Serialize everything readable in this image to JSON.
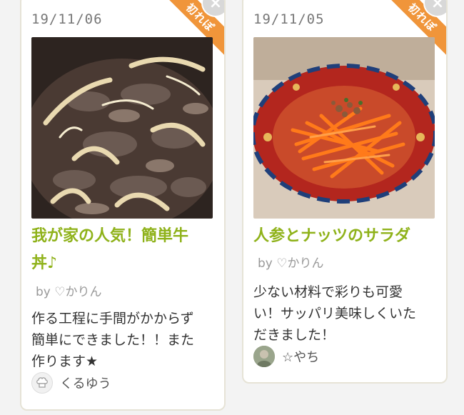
{
  "cards": [
    {
      "date": "19/11/06",
      "ribbon_label": "初れぽ",
      "close_label": "×",
      "photo_icon": "beef-bowl-photo",
      "title_line1": "我が家の人気！簡単牛",
      "title_line2": "丼♪",
      "author": "by ♡かりん",
      "comment_lines": [
        "作る工程に手間がかからず",
        "簡単にできました！！また",
        "作ります★"
      ],
      "reporter_name": "くるゆう",
      "reporter_icon": "chef-hat-icon"
    },
    {
      "date": "19/11/05",
      "ribbon_label": "初れぽ",
      "close_label": "×",
      "photo_icon": "carrot-salad-photo",
      "title_line1": "人参とナッツのサラダ",
      "author": "by ♡かりん",
      "comment_lines": [
        "少ない材料で彩りも可愛",
        "い！サッパリ美味しくいた",
        "だきました！"
      ],
      "reporter_name": "☆やち",
      "reporter_icon": "user-photo-avatar"
    }
  ],
  "colors": {
    "title": "#8fb21a",
    "ribbon": "#f0953a",
    "card_border": "#e6e3d6"
  }
}
